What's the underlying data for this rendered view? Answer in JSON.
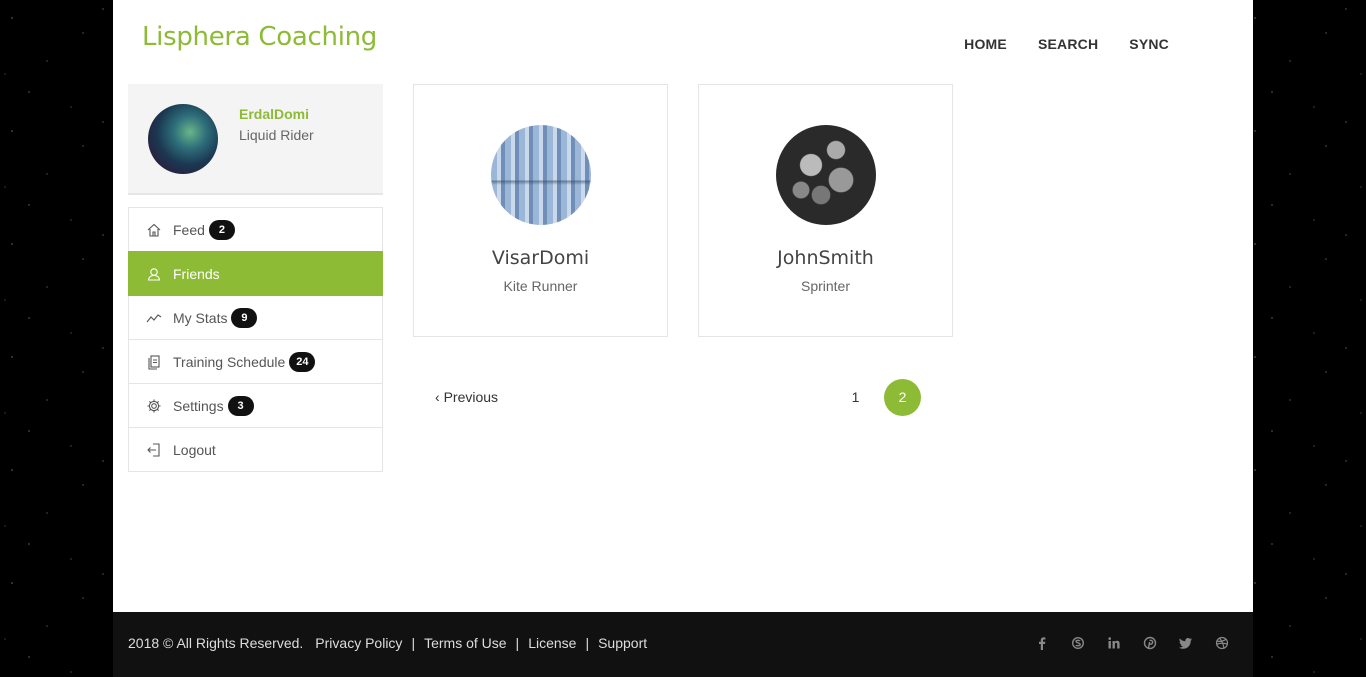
{
  "brand": "Lisphera Coaching",
  "nav": [
    "HOME",
    "SEARCH",
    "SYNC"
  ],
  "profile": {
    "username": "ErdalDomi",
    "role": "Liquid Rider"
  },
  "menu": [
    {
      "label": "Feed",
      "icon": "home-icon",
      "badge": "2"
    },
    {
      "label": "Friends",
      "icon": "user-icon",
      "badge": null,
      "active": true
    },
    {
      "label": "My Stats",
      "icon": "stats-line-icon",
      "badge": "9"
    },
    {
      "label": "Training Schedule",
      "icon": "document-icon",
      "badge": "24"
    },
    {
      "label": "Settings",
      "icon": "gear-icon",
      "badge": "3"
    },
    {
      "label": "Logout",
      "icon": "logout-icon",
      "badge": null
    }
  ],
  "friends": [
    {
      "name": "VisarDomi",
      "role": "Kite Runner"
    },
    {
      "name": "JohnSmith",
      "role": "Sprinter"
    }
  ],
  "pagination": {
    "previous": "Previous",
    "pages": [
      "1",
      "2"
    ],
    "current": "2"
  },
  "footer": {
    "copyright": "2018 © All Rights Reserved.",
    "links": [
      "Privacy Policy",
      "Terms of Use",
      "License",
      "Support"
    ],
    "social": [
      "facebook-icon",
      "skype-icon",
      "linkedin-icon",
      "pinterest-icon",
      "twitter-icon",
      "dribbble-icon"
    ]
  },
  "colors": {
    "accent": "#8dbb35",
    "footer_bg": "#111111",
    "badge_bg": "#111111"
  }
}
